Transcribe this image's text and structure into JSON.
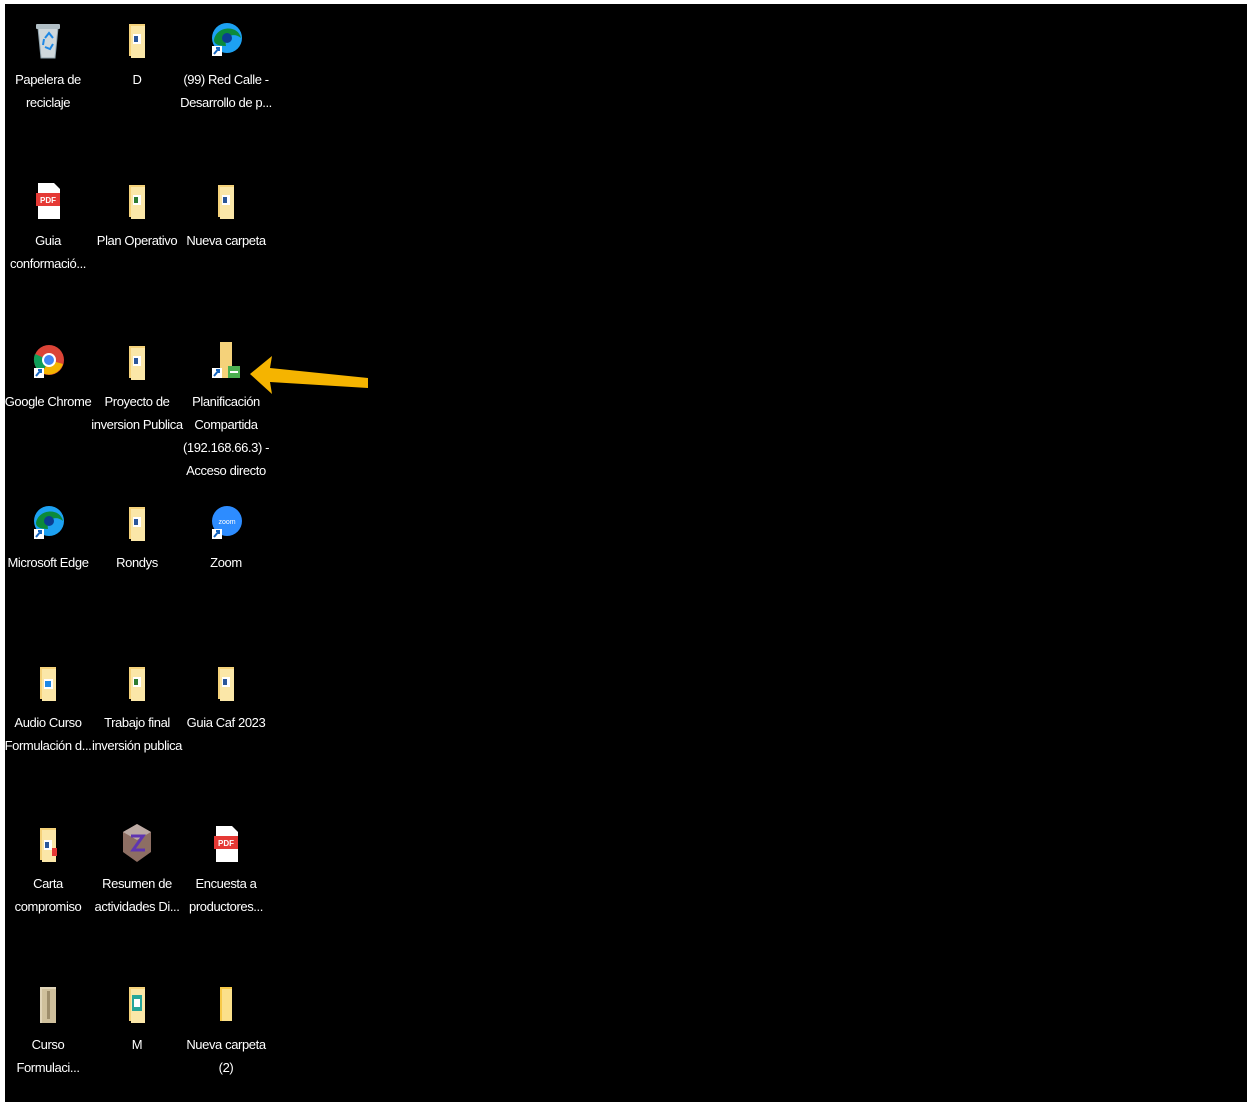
{
  "desktop": {
    "background": "#000000",
    "icons": [
      {
        "label": "Papelera de\nreciclaje",
        "icon": "recycle-bin-icon"
      },
      {
        "label": "D",
        "icon": "document-file-icon"
      },
      {
        "label": "(99) Red Calle -\nDesarrollo de p...",
        "icon": "edge-shortcut-icon"
      },
      {
        "label": "Guia\nconformació...",
        "icon": "pdf-file-icon"
      },
      {
        "label": "Plan Operativo",
        "icon": "document-file-icon"
      },
      {
        "label": "Nueva carpeta",
        "icon": "document-file-icon"
      },
      {
        "label": "Google Chrome",
        "icon": "chrome-icon"
      },
      {
        "label": "Proyecto de\ninversion Publica",
        "icon": "document-file-icon"
      },
      {
        "label": "Planificación\nCompartida\n(192.168.66.3) -\nAcceso directo",
        "icon": "network-shortcut-icon"
      },
      {
        "label": "Microsoft Edge",
        "icon": "edge-shortcut-icon"
      },
      {
        "label": "Rondys",
        "icon": "document-file-icon"
      },
      {
        "label": "Zoom",
        "icon": "zoom-icon"
      },
      {
        "label": "Audio Curso\nFormulación d...",
        "icon": "audio-file-icon"
      },
      {
        "label": "Trabajo final\ninversión publica",
        "icon": "document-file-icon"
      },
      {
        "label": "Guia Caf 2023",
        "icon": "document-file-icon"
      },
      {
        "label": "Carta\ncompromiso",
        "icon": "document-file-icon"
      },
      {
        "label": "Resumen de\nactividades Di...",
        "icon": "winrar-archive-icon"
      },
      {
        "label": "Encuesta a\nproductores...",
        "icon": "pdf-file-icon"
      },
      {
        "label": "Curso\nFormulaci...",
        "icon": "archive-file-icon"
      },
      {
        "label": "M",
        "icon": "document-file-icon"
      },
      {
        "label": "Nueva carpeta (2)",
        "icon": "folder-icon"
      }
    ],
    "annotation": {
      "icon": "arrow-left-icon",
      "color": "#f5b400"
    }
  }
}
